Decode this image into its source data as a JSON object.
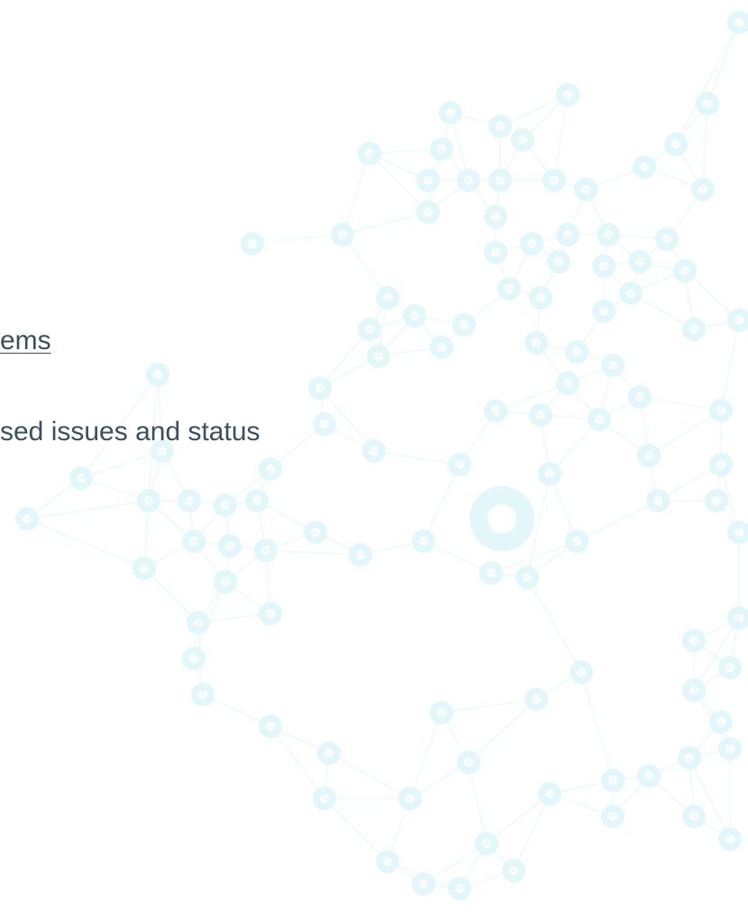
{
  "content": {
    "link_text": "ems",
    "description_text": "sed issues and status"
  },
  "colors": {
    "text": "#3d4f5c",
    "network_node": "#e3f6fa",
    "network_link": "#eef9fb"
  }
}
